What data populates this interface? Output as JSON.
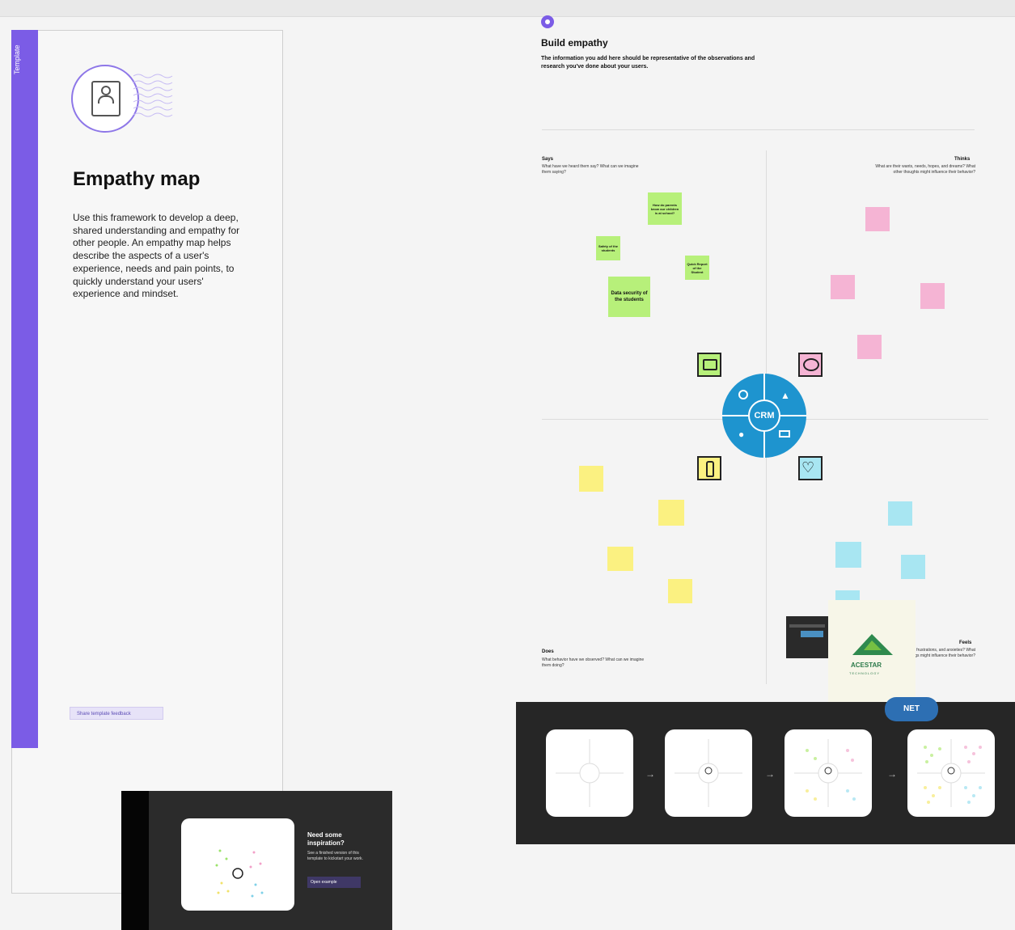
{
  "template": {
    "side_tab": "Template",
    "title": "Empathy map",
    "description": "Use this framework to develop a deep, shared understanding and empathy for other people. An empathy map helps describe the aspects of a user's experience, needs and pain points, to quickly understand your users' experience and mindset.",
    "feedback_button": "Share template feedback"
  },
  "inspiration": {
    "title": "Need some inspiration?",
    "text": "See a finished version of this template to kickstart your work.",
    "button": "Open example"
  },
  "board": {
    "title": "Build empathy",
    "subtitle": "The information you add here should be representative of the observations and research you've done about your users.",
    "quadrants": {
      "says": {
        "label": "Says",
        "text": "What have we heard them say? What can we imagine them saying?"
      },
      "thinks": {
        "label": "Thinks",
        "text": "What are their wants, needs, hopes, and dreams? What other thoughts might influence their behavior?"
      },
      "does": {
        "label": "Does",
        "text": "What behavior have we observed? What can we imagine them doing?"
      },
      "feels": {
        "label": "Feels",
        "text": "What are their fears, frustrations, and anxieties? What other feelings might influence their behavior?"
      }
    },
    "notes": {
      "green1": "How do parents know our children is at school?",
      "green2": "Safety of the students",
      "green3": "Quick Report of the Student",
      "green4": "Data security of the students"
    },
    "center_logo": "CRM"
  },
  "overlay": {
    "acestar": "ACESTAR",
    "acestar_sub": "TECHNOLOGY",
    "net_badge": "NET"
  },
  "colors": {
    "accent": "#7b5ce6",
    "crm": "#1e94cf",
    "green_note": "#b7f07a",
    "pink_note": "#f5b4d4",
    "yellow_note": "#fbf181",
    "cyan_note": "#a8e6f2"
  }
}
